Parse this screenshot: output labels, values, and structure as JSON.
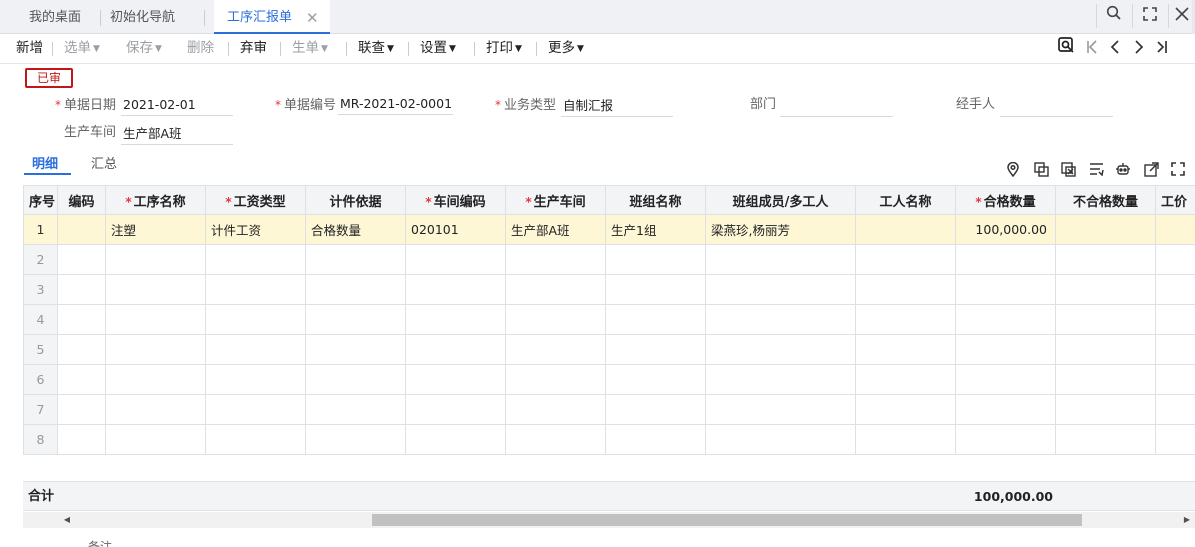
{
  "tabs": {
    "t1": "我的桌面",
    "t2": "初始化导航",
    "active": "工序汇报单",
    "close_glyph": "✕"
  },
  "toolbar": {
    "new": "新增",
    "select": "选单",
    "save": "保存",
    "delete": "删除",
    "abandon": "弃审",
    "generate": "生单",
    "link": "联查",
    "settings": "设置",
    "print": "打印",
    "more": "更多"
  },
  "status": {
    "stamp": "已审"
  },
  "form": {
    "date_label": "单据日期",
    "date_value": "2021-02-01",
    "code_label": "单据编号",
    "code_value": "MR-2021-02-0001",
    "biz_label": "业务类型",
    "biz_value": "自制汇报",
    "dept_label": "部门",
    "dept_value": "",
    "handler_label": "经手人",
    "handler_value": "",
    "workshop_label": "生产车间",
    "workshop_value": "生产部A班"
  },
  "detail_tabs": {
    "detail": "明细",
    "summary": "汇总"
  },
  "grid": {
    "columns": [
      "序号",
      "编码",
      "工序名称",
      "工资类型",
      "计件依据",
      "车间编码",
      "生产车间",
      "班组名称",
      "班组成员/多工人",
      "工人名称",
      "合格数量",
      "不合格数量",
      "工价"
    ],
    "rows": [
      {
        "idx": "1",
        "code": "",
        "process": "注塑",
        "wage_type": "计件工资",
        "basis": "合格数量",
        "ws_code": "020101",
        "workshop": "生产部A班",
        "team": "生产1组",
        "members": "梁燕珍,杨丽芳",
        "worker": "",
        "qualified": "100,000.00",
        "unqualified": "",
        "price": ""
      },
      {
        "idx": "2"
      },
      {
        "idx": "3"
      },
      {
        "idx": "4"
      },
      {
        "idx": "5"
      },
      {
        "idx": "6"
      },
      {
        "idx": "7"
      },
      {
        "idx": "8"
      }
    ]
  },
  "totals": {
    "label": "合计",
    "qualified": "100,000.00"
  },
  "remark_label": "备注"
}
